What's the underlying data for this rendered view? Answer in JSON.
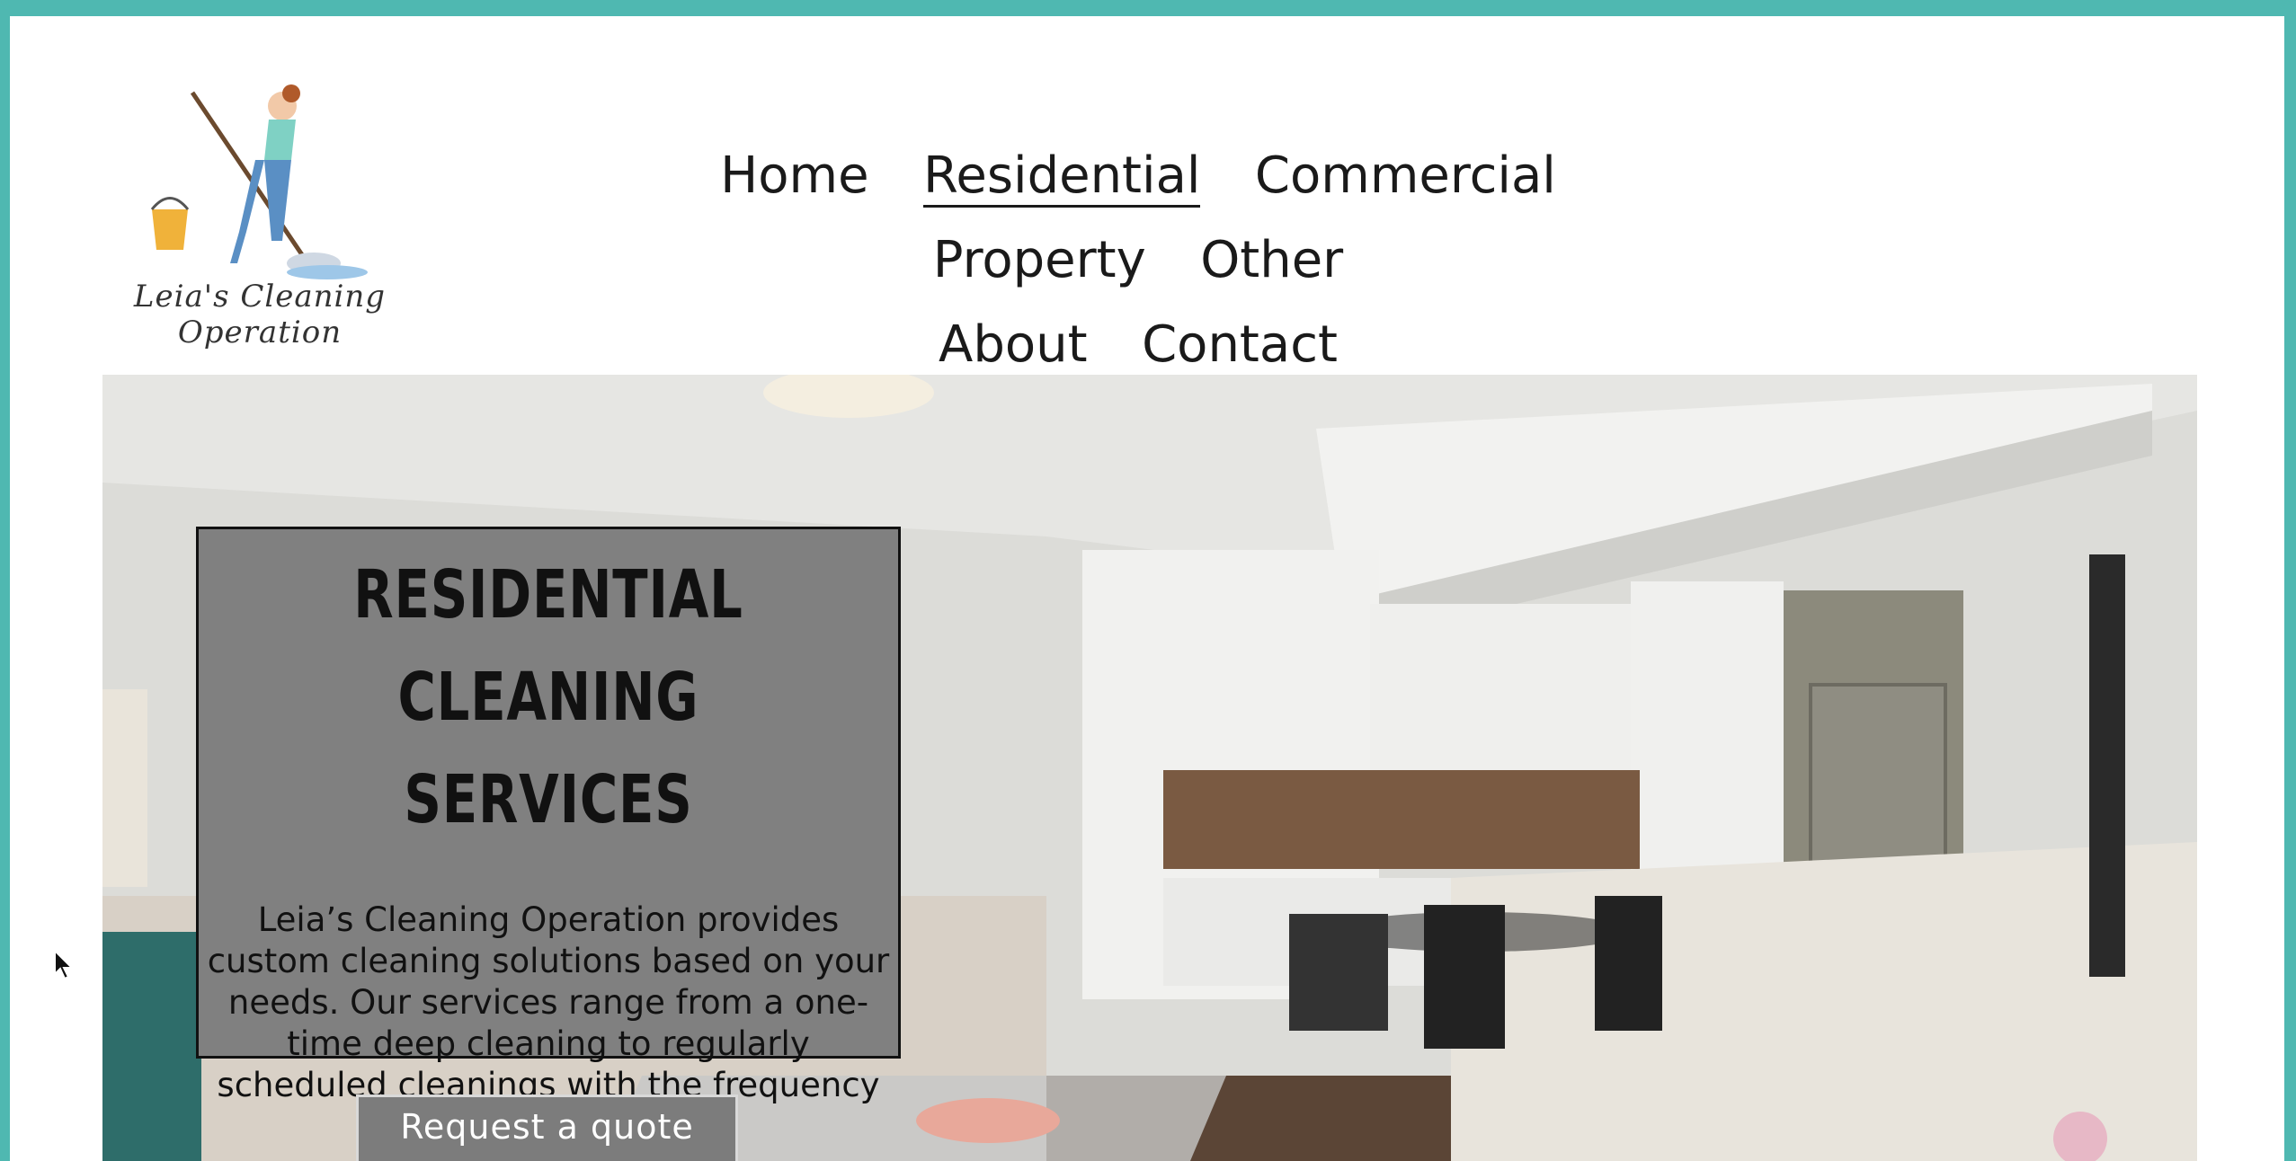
{
  "brand": {
    "logo_text": "Leia's Cleaning Operation"
  },
  "nav": {
    "items": [
      {
        "label": "Home"
      },
      {
        "label": "Residential"
      },
      {
        "label": "Commercial"
      },
      {
        "label": "Property"
      },
      {
        "label": "Other"
      },
      {
        "label": "About"
      },
      {
        "label": "Contact"
      }
    ],
    "active": "Residential"
  },
  "hero": {
    "title": "RESIDENTIAL CLEANING SERVICES",
    "description": "Leia’s Cleaning Operation provides custom cleaning solutions based on your needs. Our services range from a one-time deep cleaning to regularly scheduled cleanings with the frequency you desire.",
    "cta_label": "Request a quote"
  },
  "colors": {
    "frame": "#4fb8b1",
    "overlay": "#808080",
    "accent": "#1a1a1a"
  }
}
